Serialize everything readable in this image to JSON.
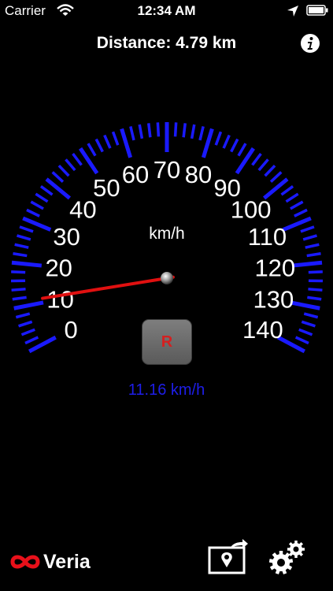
{
  "status_bar": {
    "carrier": "Carrier",
    "time": "12:34 AM"
  },
  "header": {
    "distance": "Distance: 4.79 km"
  },
  "gauge": {
    "unit": "km/h",
    "min": 0,
    "max": 140,
    "labels": [
      "0",
      "10",
      "20",
      "30",
      "40",
      "50",
      "60",
      "70",
      "80",
      "90",
      "100",
      "110",
      "120",
      "130",
      "140"
    ],
    "current_speed": 11.16,
    "speed_text": "11.16 km/h",
    "gear": "R"
  },
  "footer": {
    "brand": "Veria"
  },
  "colors": {
    "tick": "#1a1aff",
    "speed_text": "#1e1ee8",
    "needle": "#e01010",
    "gear_text": "#d42020",
    "brand_logo": "#e8101a"
  },
  "icons": {
    "wifi": "wifi-icon",
    "location": "location-arrow-icon",
    "battery": "battery-icon",
    "info": "info-icon",
    "map": "map-share-icon",
    "settings": "gears-icon",
    "logo": "infinity-logo-icon"
  }
}
